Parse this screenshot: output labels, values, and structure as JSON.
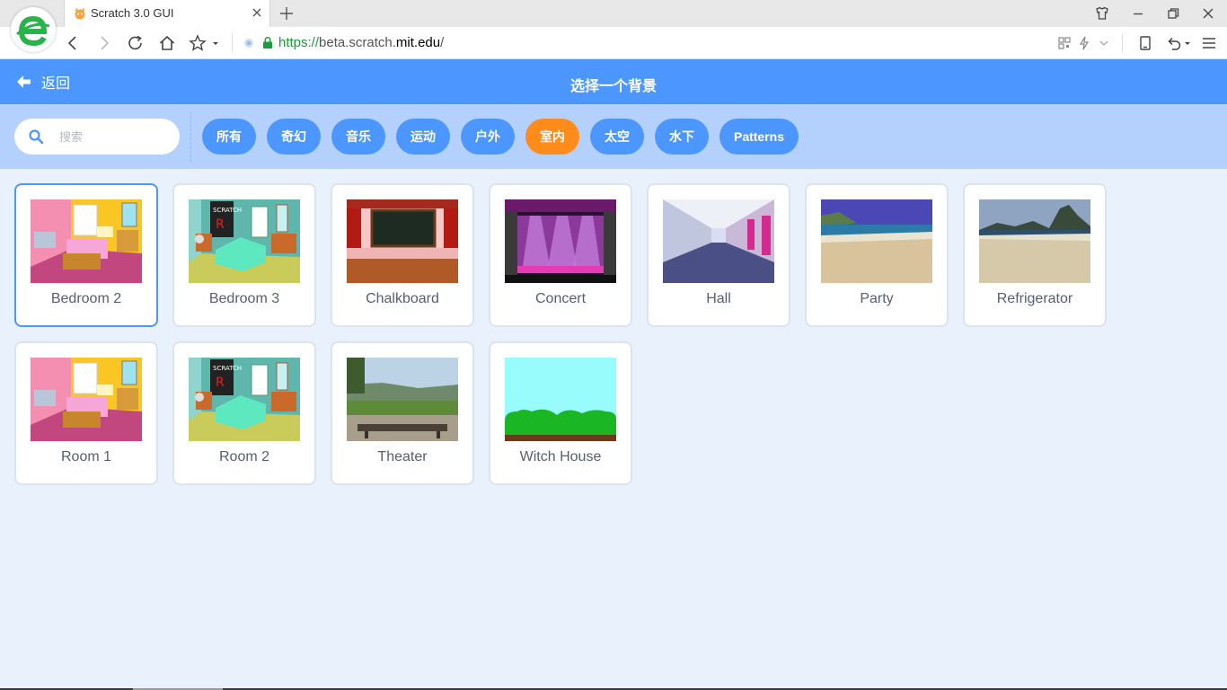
{
  "browser": {
    "tab_title": "Scratch 3.0 GUI",
    "url_scheme": "https://",
    "url_subdomain": "beta.scratch.",
    "url_domain": "mit.edu",
    "url_path": "/"
  },
  "header": {
    "back_label": "返回",
    "title": "选择一个背景"
  },
  "search": {
    "placeholder": "搜索"
  },
  "tags": [
    {
      "label": "所有",
      "active": false
    },
    {
      "label": "奇幻",
      "active": false
    },
    {
      "label": "音乐",
      "active": false
    },
    {
      "label": "运动",
      "active": false
    },
    {
      "label": "户外",
      "active": false
    },
    {
      "label": "室内",
      "active": true
    },
    {
      "label": "太空",
      "active": false
    },
    {
      "label": "水下",
      "active": false
    },
    {
      "label": "Patterns",
      "active": false
    }
  ],
  "items": [
    {
      "name": "Bedroom 2",
      "selected": true
    },
    {
      "name": "Bedroom 3",
      "selected": false
    },
    {
      "name": "Chalkboard",
      "selected": false
    },
    {
      "name": "Concert",
      "selected": false
    },
    {
      "name": "Hall",
      "selected": false
    },
    {
      "name": "Party",
      "selected": false
    },
    {
      "name": "Refrigerator",
      "selected": false
    },
    {
      "name": "Room 1",
      "selected": false
    },
    {
      "name": "Room 2",
      "selected": false
    },
    {
      "name": "Theater",
      "selected": false
    },
    {
      "name": "Witch House",
      "selected": false
    }
  ],
  "colors": {
    "header": "#4c97ff",
    "filterbar": "#b3d1fc",
    "active_tag": "#ff8c1a",
    "tag": "#4c97ff",
    "background": "#e9f1fc"
  }
}
